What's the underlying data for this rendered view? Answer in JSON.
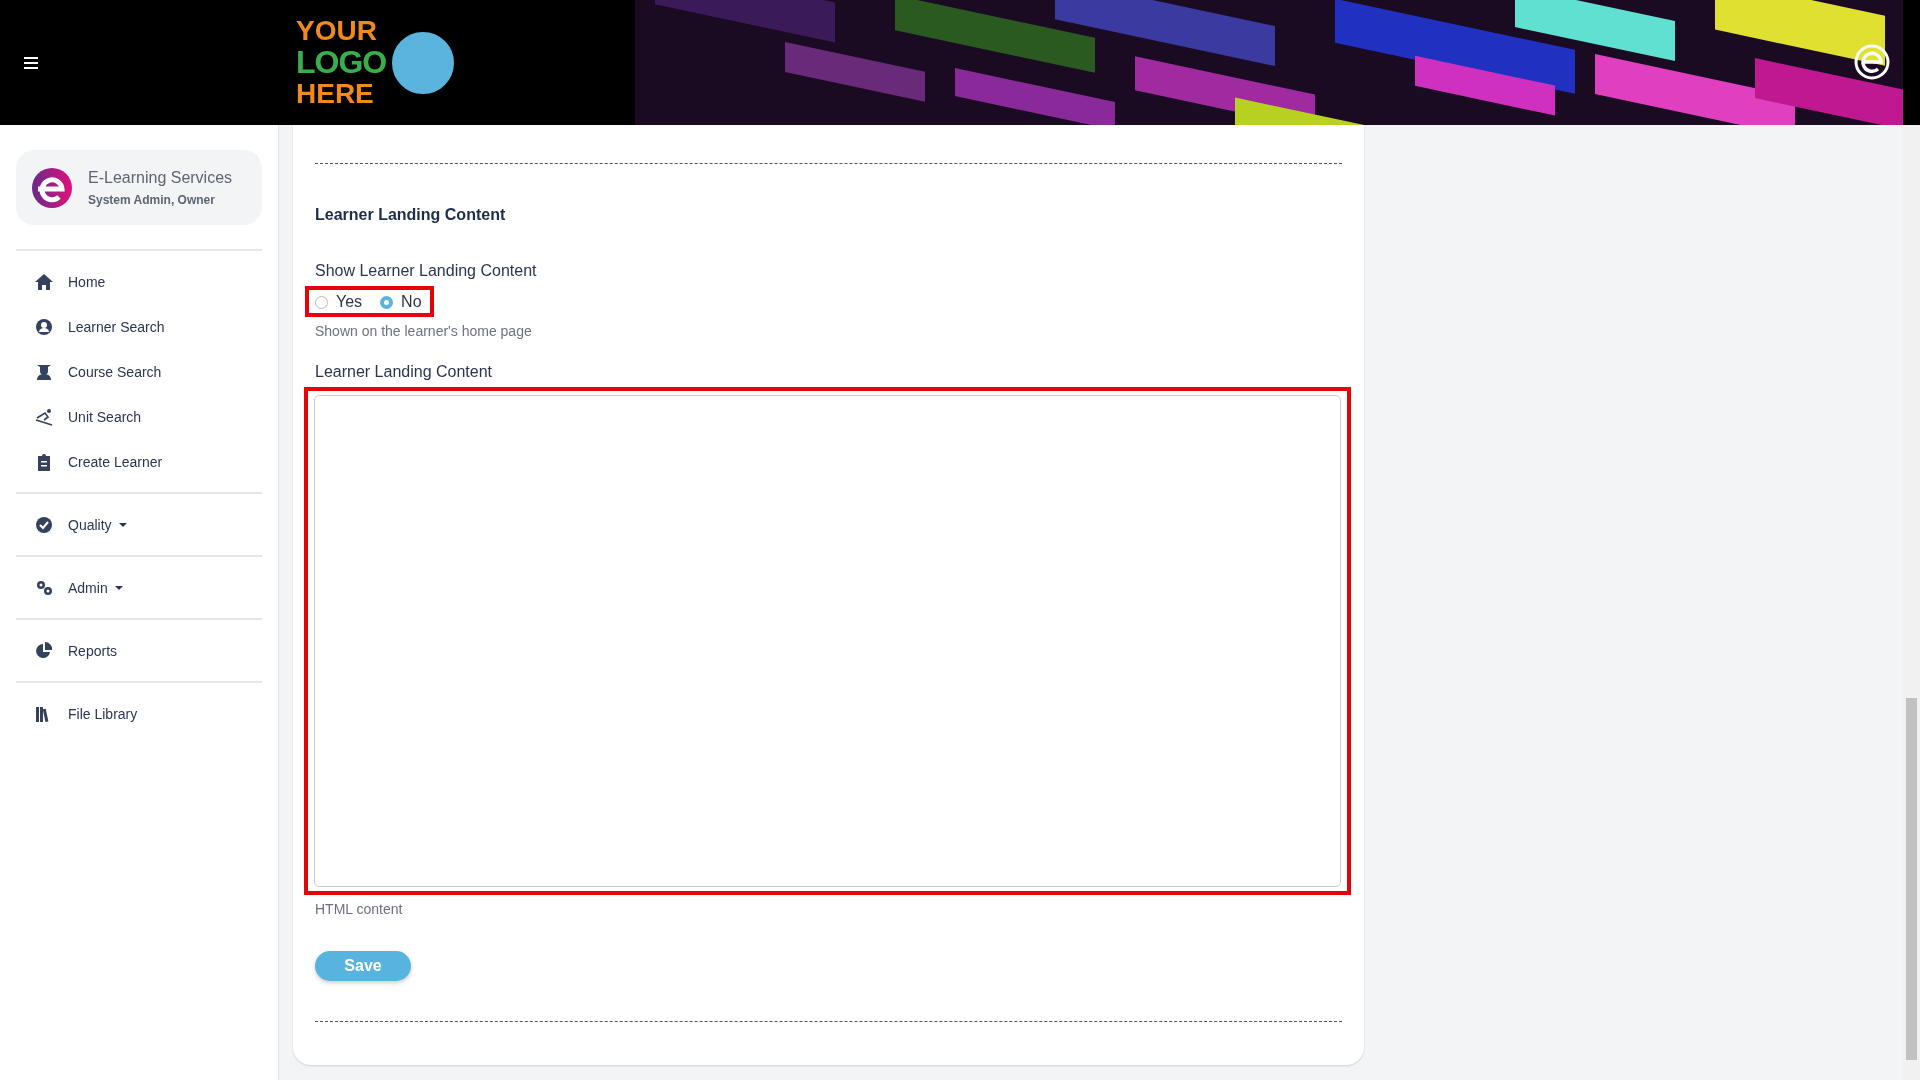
{
  "header": {
    "logo_lines": [
      "YOUR",
      "LOGO",
      "HERE"
    ]
  },
  "profile": {
    "name": "E-Learning Services",
    "role": "System Admin, Owner"
  },
  "nav_groups": [
    [
      {
        "label": "Home",
        "kind": "link"
      },
      {
        "label": "Learner Search",
        "kind": "link"
      },
      {
        "label": "Course Search",
        "kind": "link"
      },
      {
        "label": "Unit Search",
        "kind": "link"
      },
      {
        "label": "Create Learner",
        "kind": "link"
      }
    ],
    [
      {
        "label": "Quality",
        "kind": "dropdown"
      }
    ],
    [
      {
        "label": "Admin",
        "kind": "dropdown"
      }
    ],
    [
      {
        "label": "Reports",
        "kind": "link"
      }
    ],
    [
      {
        "label": "File Library",
        "kind": "link"
      }
    ]
  ],
  "form": {
    "section_title": "Learner Landing Content",
    "show_field": {
      "label": "Show Learner Landing Content",
      "options": [
        {
          "label": "Yes",
          "selected": false
        },
        {
          "label": "No",
          "selected": true
        }
      ],
      "help": "Shown on the learner's home page"
    },
    "content_field": {
      "label": "Learner Landing Content",
      "help": "HTML content"
    },
    "save_button": "Save"
  }
}
